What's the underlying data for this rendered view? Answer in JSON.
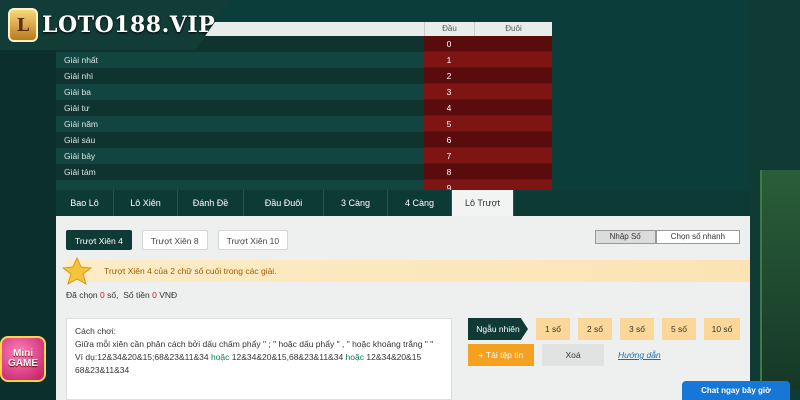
{
  "brand": {
    "name": "LOTO188.VIP",
    "badge_glyph": "L"
  },
  "results": {
    "header": {
      "dau": "Đầu",
      "duoi": "Đuôi"
    },
    "rows": [
      {
        "label": "",
        "dau": "0"
      },
      {
        "label": "Giải nhất",
        "dau": "1"
      },
      {
        "label": "Giải nhì",
        "dau": "2"
      },
      {
        "label": "Giải ba",
        "dau": "3"
      },
      {
        "label": "Giải tư",
        "dau": "4"
      },
      {
        "label": "Giải năm",
        "dau": "5"
      },
      {
        "label": "Giải sáu",
        "dau": "6"
      },
      {
        "label": "Giải bảy",
        "dau": "7"
      },
      {
        "label": "Giải tám",
        "dau": "8"
      },
      {
        "label": "",
        "dau": "9"
      }
    ]
  },
  "tabs": [
    "Bao Lô",
    "Lô Xiên",
    "Đánh Đề",
    "Đầu Đuôi",
    "3 Càng",
    "4 Càng",
    "Lô Trượt"
  ],
  "active_tab": "Lô Trượt",
  "subtabs": [
    "Trượt Xiên 4",
    "Trượt Xiên 8",
    "Trượt Xiên 10"
  ],
  "mode": {
    "manual": "Nhập Số",
    "quick": "Chọn số nhanh"
  },
  "notice": "Trượt Xiên 4 của 2 chữ số cuối trong các giải.",
  "summary": {
    "selected_label": "Đã chọn",
    "selected_count": "0",
    "selected_unit": "số,",
    "money_label": "Số tiền",
    "money_value": "0",
    "currency": "VNĐ"
  },
  "howto": {
    "title": "Cách chơi:",
    "line1": "Giữa mỗi xiên cần phân cách bởi dấu chấm phẩy \" ; \" hoặc dấu phẩy \" , \" hoặc khoảng trắng \" \"",
    "example_prefix": "Ví dụ:12&34&20&15;68&23&11&34",
    "or1": "hoặc",
    "example2": "12&34&20&15,68&23&11&34",
    "or2": "hoặc",
    "example3": "12&34&20&15",
    "example4": "68&23&11&34"
  },
  "random": {
    "label": "Ngẫu nhiên",
    "options": [
      "1 số",
      "2 số",
      "3 số",
      "5 số",
      "10 số"
    ]
  },
  "actions": {
    "upload": "+ Tải tệp tin",
    "clear": "Xoá",
    "guide": "Hướng dẫn"
  },
  "minigame": {
    "line1": "Mini",
    "line2": "GAME"
  },
  "chat": "Chat ngay bây giờ",
  "colors": {
    "brand_dark": "#0f3a35",
    "result_red": "#7d1515",
    "accent_orange": "#f3a11e",
    "chat_blue": "#1677d6"
  }
}
